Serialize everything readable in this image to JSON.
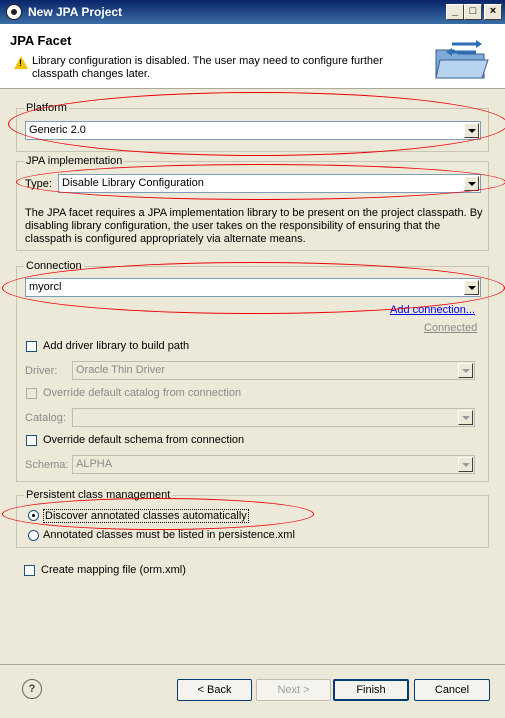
{
  "window": {
    "title": "New JPA Project",
    "icon": "eclipse-icon",
    "controls": {
      "minimize": "_",
      "maximize": "□",
      "close": "×"
    }
  },
  "header": {
    "title": "JPA Facet",
    "message": "Library configuration is disabled. The user may need to configure further classpath changes later.",
    "icon": "folder-arrows-icon"
  },
  "platform": {
    "label": "Platform",
    "value": "Generic 2.0"
  },
  "jpa_impl": {
    "label": "JPA implementation",
    "type_label": "Type:",
    "type_value": "Disable Library Configuration",
    "description": "The JPA facet requires a JPA implementation library to be present on the project classpath. By disabling library configuration, the user takes on the responsibility of ensuring that the classpath is configured appropriately via alternate means."
  },
  "connection": {
    "label": "Connection",
    "value": "myorcl",
    "add_link": "Add connection...",
    "status": "Connected",
    "add_driver": "Add driver library to build path",
    "driver_label": "Driver:",
    "driver_value": "Oracle Thin Driver",
    "override_catalog": "Override default catalog from connection",
    "catalog_label": "Catalog:",
    "catalog_value": "",
    "override_schema": "Override default schema from connection",
    "schema_label": "Schema:",
    "schema_value": "ALPHA"
  },
  "persistent": {
    "label": "Persistent class management",
    "option1": "Discover annotated classes automatically",
    "option2": "Annotated classes must be listed in persistence.xml",
    "selected": "option1"
  },
  "mapping": {
    "label": "Create mapping file (orm.xml)"
  },
  "buttons": {
    "help": "?",
    "back": "< Back",
    "next": "Next >",
    "finish": "Finish",
    "cancel": "Cancel"
  },
  "colors": {
    "annotation": "#e00000",
    "titlebar": "#0a246a"
  }
}
